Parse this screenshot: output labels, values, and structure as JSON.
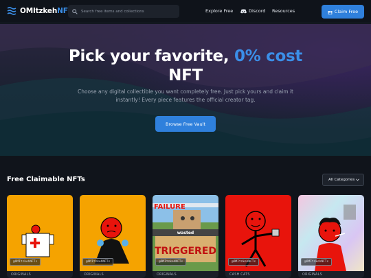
{
  "nav": {
    "logo_main": "OMItzkeh",
    "logo_accent": "NFTs",
    "search_placeholder": "Search free items and collections",
    "links": [
      "Explore Free",
      "Discord",
      "Resources"
    ],
    "claim_label": "Claim Free"
  },
  "hero": {
    "title_main": "Pick your favorite, ",
    "title_accent": "0% cost",
    "title_end": "NFT",
    "subtitle": "Choose any digital collectible you want completely free. Just pick yours and claim it instantly! Every piece features the official creator tag.",
    "cta_label": "Browse Free Vault"
  },
  "section": {
    "title": "Free Claimable NFTs",
    "category_selected": "All Categories"
  },
  "cards": [
    {
      "tag": "@OMItzkehNFTs",
      "category": "ORIGINALS",
      "bg": "#f5a300"
    },
    {
      "tag": "@OMItzkehNFTs",
      "category": "ORIGINALS",
      "bg": "#f5a300"
    },
    {
      "tag": "@OMItzkehNFTs",
      "category": "ORIGINALS",
      "bg": "#6a9a4a",
      "meme_top": "FAILURE",
      "meme_mid": "wasted",
      "meme_bottom": "TRIGGERED"
    },
    {
      "tag": "@OMItzkehNFTs",
      "category": "CASH CATS",
      "bg": "#e8140c"
    },
    {
      "tag": "@OMItzkehNFTs",
      "category": "ORIGINALS",
      "bg": "#c9b8e6"
    }
  ],
  "colors": {
    "accent": "#3b8fe8",
    "button": "#2f80dc",
    "background": "#10141b"
  }
}
